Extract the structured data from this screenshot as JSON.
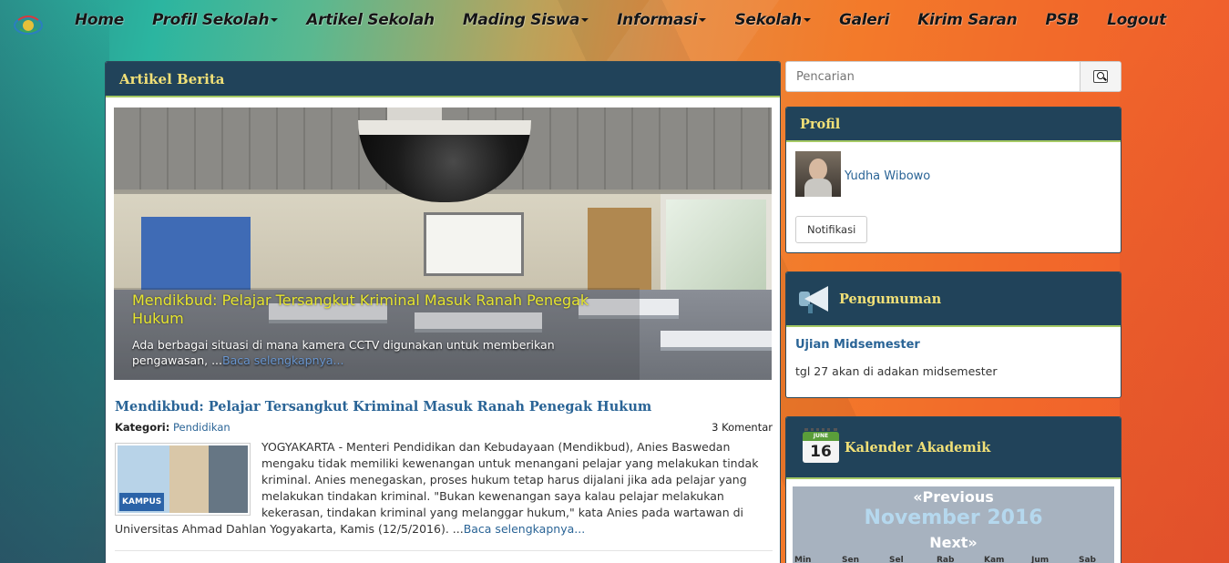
{
  "nav": {
    "items": [
      {
        "label": "Home",
        "dropdown": false
      },
      {
        "label": "Profil Sekolah",
        "dropdown": true
      },
      {
        "label": "Artikel Sekolah",
        "dropdown": false
      },
      {
        "label": "Mading Siswa",
        "dropdown": true
      },
      {
        "label": "Informasi",
        "dropdown": true
      },
      {
        "label": "Sekolah",
        "dropdown": true
      },
      {
        "label": "Galeri",
        "dropdown": false
      },
      {
        "label": "Kirim Saran",
        "dropdown": false
      },
      {
        "label": "PSB",
        "dropdown": false
      },
      {
        "label": "Logout",
        "dropdown": false
      }
    ]
  },
  "main": {
    "title": "Artikel Berita",
    "slider": {
      "title": "Mendikbud: Pelajar Tersangkut Kriminal Masuk Ranah Penegak Hukum",
      "text": "Ada berbagai situasi di mana kamera CCTV digunakan untuk memberikan pengawasan, ...",
      "link": "Baca selengkapnya..."
    },
    "article": {
      "title": "Mendikbud: Pelajar Tersangkut Kriminal Masuk Ranah Penegak Hukum",
      "category_label": "Kategori:",
      "category": "Pendidikan",
      "comments": "3 Komentar",
      "thumb_label": "KAMPUS",
      "body": "YOGYAKARTA - Menteri Pendidikan dan Kebudayaan (Mendikbud), Anies Baswedan mengaku tidak memiliki kewenangan untuk menangani pelajar yang melakukan tindak kriminal. Anies menegaskan, proses hukum tetap harus dijalani jika ada pelajar yang melakukan tindakan kriminal. \"Bukan kewenangan saya kalau pelajar melakukan kekerasan, tindakan kriminal yang melanggar hukum,\" kata Anies pada wartawan di Universitas Ahmad Dahlan Yogyakarta, Kamis (12/5/2016). ...",
      "read_more": "Baca selengkapnya..."
    }
  },
  "search": {
    "placeholder": "Pencarian",
    "icon": "search-icon"
  },
  "profile": {
    "title": "Profil",
    "name": "Yudha Wibowo",
    "button": "Notifikasi"
  },
  "announcement": {
    "title": "Pengumuman",
    "item_title": "Ujian Midsemester",
    "item_text": "tgl 27 akan di adakan midsemester"
  },
  "calendar": {
    "title": "Kalender Akademik",
    "icon_month": "JUNE",
    "icon_day": "16",
    "prev": "«Previous",
    "month": "November 2016",
    "next": "Next»",
    "weekdays": [
      "Min",
      "Sen",
      "Sel",
      "Rab",
      "Kam",
      "Jum",
      "Sab"
    ]
  },
  "colors": {
    "header_bg": "#21435a",
    "header_text": "#f1e077",
    "link": "#2a6496",
    "accent_border": "#a5c964"
  }
}
